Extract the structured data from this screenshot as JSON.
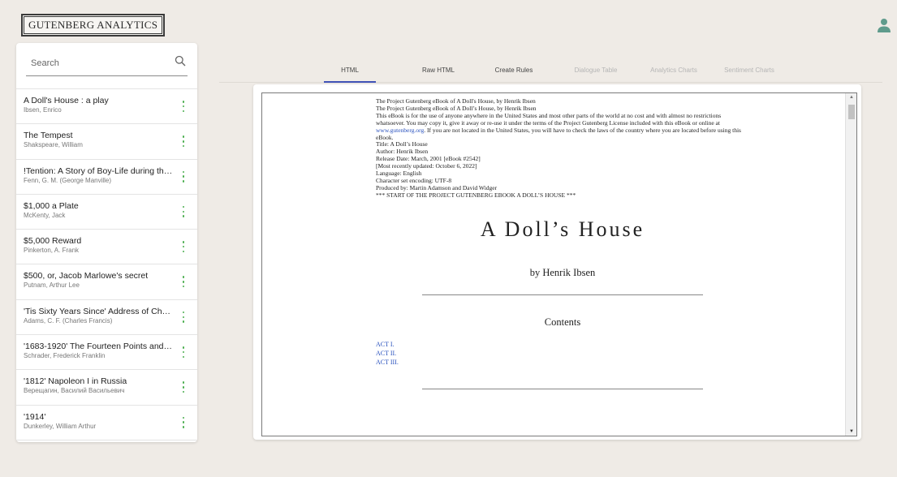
{
  "brand": {
    "logo_text": "GUTENBERG ANALYTICS"
  },
  "header": {
    "user_icon": "account-icon"
  },
  "search": {
    "placeholder": "Search",
    "value": "",
    "icon": "search-icon"
  },
  "books": [
    {
      "title": "A Doll's House : a play",
      "author": "Ibsen, Enrico"
    },
    {
      "title": "The Tempest",
      "author": "Shakspeare, William"
    },
    {
      "title": "!Tention: A Story of Boy-Life during the P...",
      "author": "Fenn, G. M. (George Manville)"
    },
    {
      "title": "$1,000 a Plate",
      "author": "McKenty, Jack"
    },
    {
      "title": "$5,000 Reward",
      "author": "Pinkerton, A. Frank"
    },
    {
      "title": "$500, or, Jacob Marlowe's secret",
      "author": "Putnam, Arthur Lee"
    },
    {
      "title": "'Tis Sixty Years Since' Address of Charle...",
      "author": "Adams, C. F. (Charles Francis)"
    },
    {
      "title": "'1683-1920' The Fourteen Points and Wh...",
      "author": "Schrader, Frederick Franklin"
    },
    {
      "title": "'1812' Napoleon I in Russia",
      "author": "Верещагин, Василий Васильевич"
    },
    {
      "title": "'1914'",
      "author": "Dunkerley, William Arthur"
    }
  ],
  "tabs": [
    {
      "label": "HTML",
      "active": true,
      "enabled": true
    },
    {
      "label": "Raw HTML",
      "active": false,
      "enabled": true
    },
    {
      "label": "Create Rules",
      "active": false,
      "enabled": true
    },
    {
      "label": "Dialogue Table",
      "active": false,
      "enabled": false
    },
    {
      "label": "Analytics Charts",
      "active": false,
      "enabled": false
    },
    {
      "label": "Sentiment Charts",
      "active": false,
      "enabled": false
    }
  ],
  "document": {
    "header_lines": [
      "The Project Gutenberg eBook of A Doll's House, by Henrik Ibsen",
      "The Project Gutenberg eBook of A Doll’s House, by Henrik Ibsen"
    ],
    "license_before_link": "This eBook is for the use of anyone anywhere in the United States and most other parts of the world at no cost and with almost no restrictions whatsoever. You may copy it, give it away or re-use it under the terms of the Project Gutenberg License included with this eBook or online at ",
    "license_link": "www.gutenberg.org",
    "license_after_link": ". If you are not located in the United States, you will have to check the laws of the country where you are located before using this eBook.",
    "meta_lines": [
      "Title: A Doll’s House",
      "Author: Henrik Ibsen",
      "Release Date: March, 2001 [eBook #2542]",
      "[Most recently updated: October 6, 2022]",
      "Language: English",
      "Character set encoding: UTF-8",
      "Produced by: Martin Adamson and David Widger",
      "*** START OF THE PROJECT GUTENBERG EBOOK A DOLL’S HOUSE ***"
    ],
    "title": "A Doll’s House",
    "byline": "by Henrik Ibsen",
    "contents_heading": "Contents",
    "toc": [
      "ACT I.",
      "ACT II.",
      "ACT III."
    ]
  },
  "colors": {
    "background": "#efebe6",
    "accent": "#3f51b5",
    "menu_dots": "#4caf50",
    "link": "#2a52be"
  }
}
